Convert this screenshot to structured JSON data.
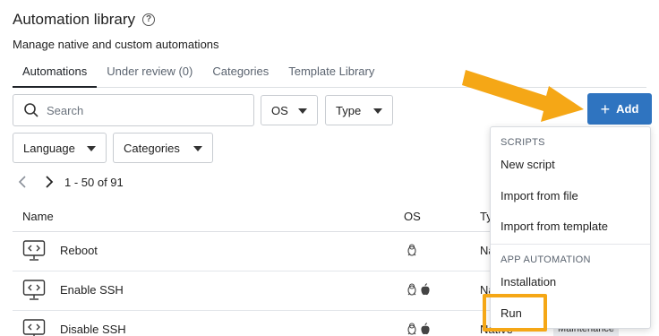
{
  "page": {
    "title": "Automation library",
    "subtitle": "Manage native and custom automations"
  },
  "tabs": [
    {
      "label": "Automations",
      "active": true
    },
    {
      "label": "Under review (0)",
      "active": false
    },
    {
      "label": "Categories",
      "active": false
    },
    {
      "label": "Template Library",
      "active": false
    }
  ],
  "filters": {
    "search_placeholder": "Search",
    "os_label": "OS",
    "type_label": "Type",
    "language_label": "Language",
    "categories_label": "Categories"
  },
  "toolbar": {
    "add_label": "Add"
  },
  "pagination": {
    "range": "1 - 50 of 91"
  },
  "table": {
    "columns": [
      "Name",
      "OS",
      "Ty"
    ],
    "rows": [
      {
        "name": "Reboot",
        "os": [
          "linux-icon"
        ],
        "type": "Na",
        "category": ""
      },
      {
        "name": "Enable SSH",
        "os": [
          "linux-icon",
          "apple-icon"
        ],
        "type": "Na",
        "category": ""
      },
      {
        "name": "Disable SSH",
        "os": [
          "linux-icon",
          "apple-icon"
        ],
        "type": "Native",
        "category": "Maintenance"
      }
    ]
  },
  "add_menu": {
    "scripts_section": "SCRIPTS",
    "new_script": "New script",
    "import_file": "Import from file",
    "import_template": "Import from template",
    "app_section": "APP AUTOMATION",
    "installation": "Installation",
    "run": "Run"
  },
  "colors": {
    "accent": "#2f74c0",
    "annotation": "#f5a716"
  }
}
